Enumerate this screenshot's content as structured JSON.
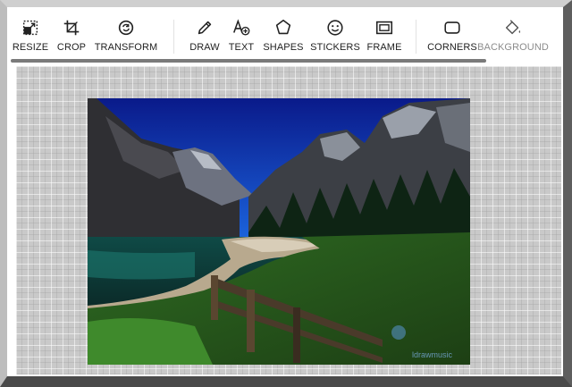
{
  "toolbar": {
    "tools": [
      {
        "label": "RESIZE",
        "icon": "resize-icon"
      },
      {
        "label": "CROP",
        "icon": "crop-icon"
      },
      {
        "label": "TRANSFORM",
        "icon": "transform-icon"
      },
      {
        "label": "DRAW",
        "icon": "pencil-icon"
      },
      {
        "label": "TEXT",
        "icon": "text-add-icon"
      },
      {
        "label": "SHAPES",
        "icon": "shapes-icon"
      },
      {
        "label": "STICKERS",
        "icon": "smiley-icon"
      },
      {
        "label": "FRAME",
        "icon": "frame-icon"
      },
      {
        "label": "CORNERS",
        "icon": "corners-icon"
      },
      {
        "label": "BACKGROUND",
        "icon": "paint-bucket-icon"
      }
    ]
  },
  "photo": {
    "watermark": "ldrawmusic"
  },
  "colors": {
    "toolbar_bg": "#ffffff",
    "label_text": "#1f1f1f",
    "label_dim": "#8c8c8c",
    "canvas_bg": "#c9c9c9"
  }
}
